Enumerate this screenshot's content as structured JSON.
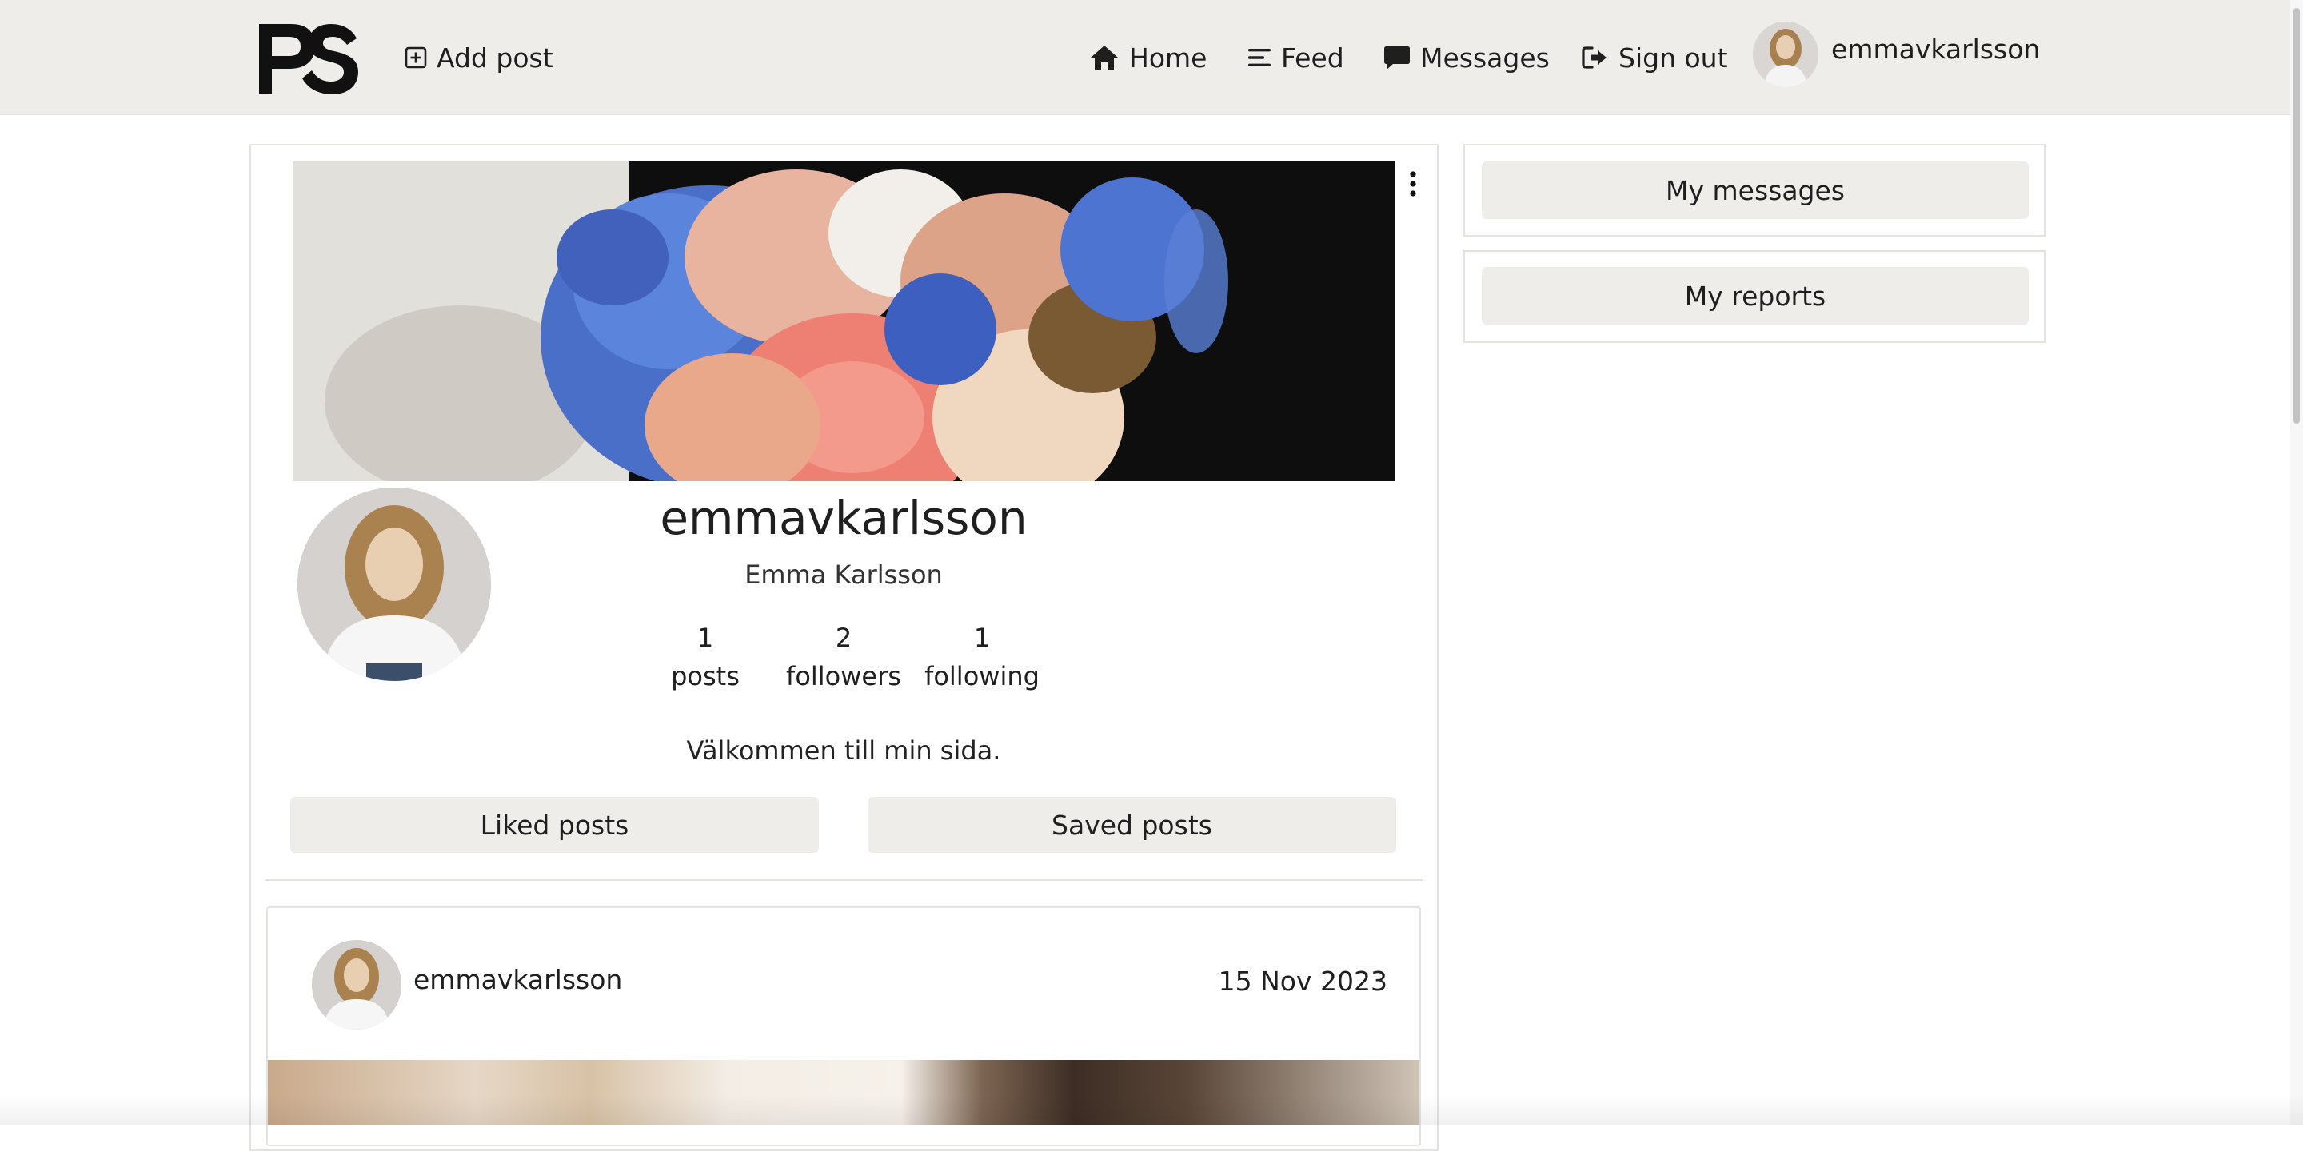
{
  "navbar": {
    "logo_text": "PS",
    "add_post": "Add post",
    "home": "Home",
    "feed": "Feed",
    "messages": "Messages",
    "sign_out": "Sign out",
    "username": "emmavkarlsson"
  },
  "profile": {
    "username": "emmavkarlsson",
    "full_name": "Emma Karlsson",
    "stats": [
      {
        "count": "1",
        "label": "posts"
      },
      {
        "count": "2",
        "label": "followers"
      },
      {
        "count": "1",
        "label": "following"
      }
    ],
    "bio": "Välkommen till min sida.",
    "liked_posts": "Liked posts",
    "saved_posts": "Saved posts"
  },
  "sidebar": {
    "my_messages": "My messages",
    "my_reports": "My reports"
  },
  "post": {
    "username": "emmavkarlsson",
    "date": "15 Nov 2023"
  },
  "colors": {
    "navbar_bg": "#efede9",
    "button_bg": "#efede9",
    "border": "#e5e3df"
  }
}
